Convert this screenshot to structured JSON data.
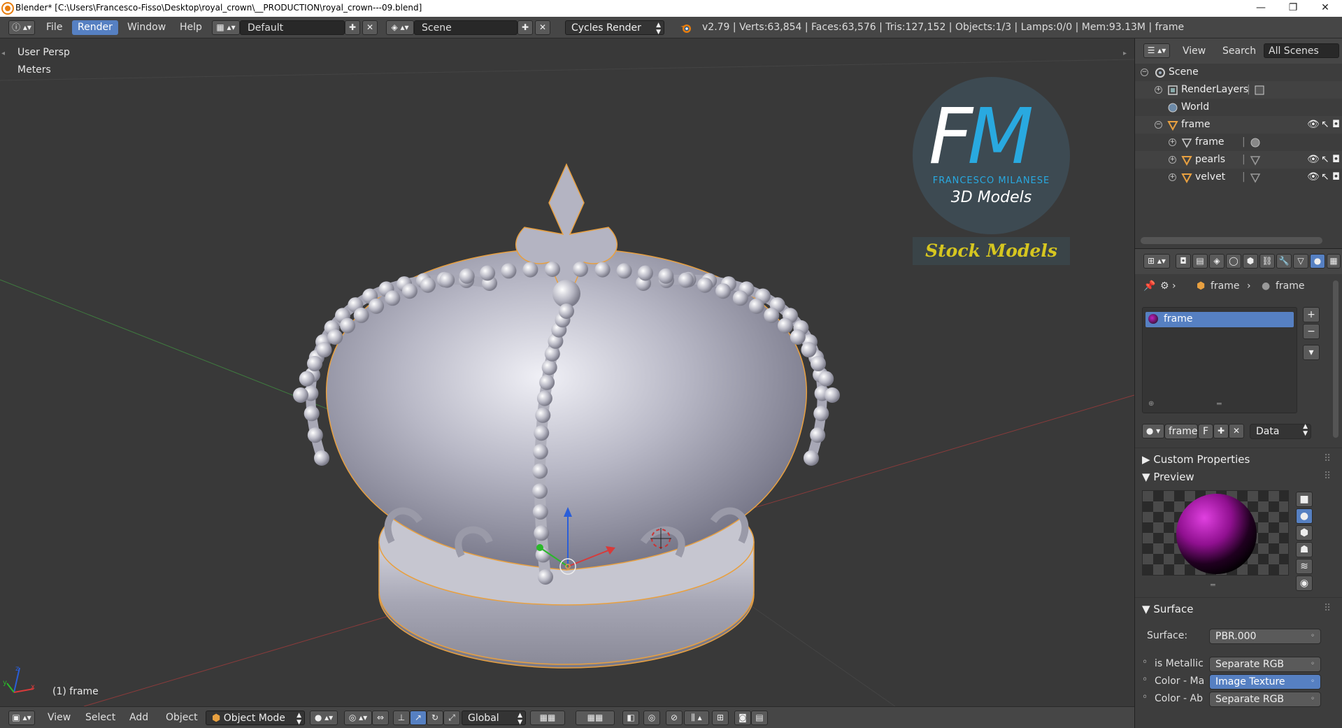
{
  "window": {
    "title": "Blender* [C:\\Users\\Francesco-Fisso\\Desktop\\royal_crown\\__PRODUCTION\\royal_crown---09.blend]",
    "minimize": "—",
    "maximize": "❐",
    "close": "✕"
  },
  "info_header": {
    "menus": [
      "File",
      "Render",
      "Window",
      "Help"
    ],
    "active_menu": "Render",
    "screen_layout": "Default",
    "scene": "Scene",
    "render_engine": "Cycles Render",
    "stats": "v2.79 | Verts:63,854 | Faces:63,576 | Tris:127,152 | Objects:1/3 | Lamps:0/0 | Mem:93.13M | frame"
  },
  "viewport": {
    "view_name": "User Persp",
    "units": "Meters",
    "object_info": "(1) frame",
    "watermark": {
      "initials_f": "F",
      "initials_m": "M",
      "name": "FRANCESCO MILANESE",
      "tagline": "3D Models",
      "banner": "Stock Models"
    }
  },
  "bottom_header": {
    "menus": [
      "View",
      "Select",
      "Add",
      "Object"
    ],
    "mode": "Object Mode",
    "orientation": "Global"
  },
  "outliner": {
    "menus": [
      "View",
      "Search"
    ],
    "filter": "All Scenes",
    "rows": [
      {
        "label": "Scene",
        "icon": "scene-icon"
      },
      {
        "label": "RenderLayers",
        "icon": "renderlayers-icon"
      },
      {
        "label": "World",
        "icon": "world-icon"
      },
      {
        "label": "frame",
        "icon": "object-icon"
      },
      {
        "label": "frame",
        "icon": "mesh-icon"
      },
      {
        "label": "pearls",
        "icon": "object-icon"
      },
      {
        "label": "velvet",
        "icon": "object-icon"
      }
    ]
  },
  "properties": {
    "breadcrumb": [
      "frame",
      "frame"
    ],
    "material_slot": "frame",
    "material_name": "frame",
    "material_users": "F",
    "link": "Data",
    "panels": {
      "custom_properties": "Custom Properties",
      "preview": "Preview",
      "surface": "Surface"
    },
    "surface": {
      "label": "Surface:",
      "value": "PBR.000"
    },
    "inputs": [
      {
        "label": "is Metallic",
        "value": "Separate RGB"
      },
      {
        "label": "Color - Ma",
        "value": "Image Texture"
      },
      {
        "label": "Color - Ab",
        "value": "Separate RGB"
      }
    ]
  },
  "colors": {
    "accent": "#5680c2",
    "selection_outline": "#e8a040",
    "brand_blue": "#29a9e0",
    "brand_yellow": "#d6c620"
  }
}
